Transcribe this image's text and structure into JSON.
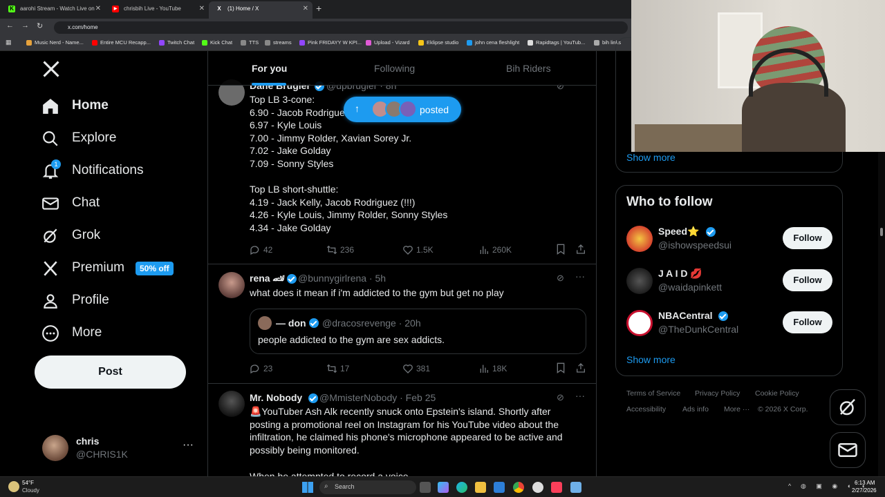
{
  "browser": {
    "tabs": [
      {
        "title": "aarohi Stream - Watch Live on",
        "fav": "K",
        "color": "#53fc18"
      },
      {
        "title": "chrisbih Live - YouTube",
        "fav": "▶",
        "color": "#ff0000"
      },
      {
        "title": "(1) Home / X",
        "fav": "X",
        "color": "#ffffff"
      }
    ],
    "url": "x.com/home",
    "bookmarks": [
      "Music Nerd - Name...",
      "Entire MCU Recapp...",
      "Twitch Chat",
      "Kick Chat",
      "TTS",
      "streams",
      "Pink FRIDAYY W KPI...",
      "Upload - Vizard",
      "Eklipse studio",
      "john cena fleshlight",
      "Rapidtags | YouTub...",
      "bih links"
    ]
  },
  "sidebar": {
    "items": [
      {
        "label": "Home",
        "icon": "home-icon"
      },
      {
        "label": "Explore",
        "icon": "search-icon"
      },
      {
        "label": "Notifications",
        "icon": "bell-icon",
        "badge": "1"
      },
      {
        "label": "Chat",
        "icon": "mail-icon"
      },
      {
        "label": "Grok",
        "icon": "grok-icon"
      },
      {
        "label": "Premium",
        "icon": "x-logo-icon",
        "badge": "50% off"
      },
      {
        "label": "Profile",
        "icon": "person-icon"
      },
      {
        "label": "More",
        "icon": "more-circle-icon"
      }
    ],
    "post_label": "Post",
    "account": {
      "name": "chris",
      "handle": "@CHRIS1K"
    }
  },
  "feed": {
    "tabs": [
      "For you",
      "Following",
      "Bih Riders"
    ],
    "posted_pill": "posted",
    "tweets": [
      {
        "name": "Dane Brugler",
        "handle": "@dpbrugler · 8h",
        "text": "Top LB 3-cone:\n6.90 - Jacob Rodriguez\n6.97 - Kyle Louis\n7.00 - Jimmy Rolder, Xavian Sorey Jr.\n7.02 - Jake Golday\n7.09 - Sonny Styles\n\nTop LB short-shuttle:\n4.19 - Jack Kelly, Jacob Rodriguez (!!!)\n4.26 - Kyle Louis, Jimmy Rolder, Sonny Styles\n4.34 - Jake Golday",
        "replies": "42",
        "reposts": "236",
        "likes": "1.5K",
        "views": "260K"
      },
      {
        "name": "rena 🏎",
        "handle": "@bunnygirlrena · 5h",
        "text": "what does it mean if i'm addicted to the gym but get no play",
        "quote": {
          "name": "— don",
          "handle": "@dracosrevenge · 20h",
          "text": "people addicted to the gym are sex addicts."
        },
        "replies": "23",
        "reposts": "17",
        "likes": "381",
        "views": "18K"
      },
      {
        "name": "Mr. Nobody",
        "handle": "@MmisterNobody · Feb 25",
        "text": "🚨YouTuber Ash Alk recently snuck onto Epstein's island. Shortly after\nposting a promotional reel on Instagram for his YouTube video about the\ninfiltration, he claimed his phone's microphone appeared to be active and\npossibly being monitored.",
        "cut_text": "When he attempted to record a voice"
      }
    ]
  },
  "right": {
    "show_more_top": "Show more",
    "who_to_follow_title": "Who to follow",
    "suggestions": [
      {
        "name": "Speed⭐",
        "handle": "@ishowspeedsui",
        "follow": "Follow"
      },
      {
        "name": "J A I D 💋",
        "handle": "@waidapinkett",
        "follow": "Follow"
      },
      {
        "name": "NBACentral",
        "handle": "@TheDunkCentral",
        "follow": "Follow"
      }
    ],
    "show_more": "Show more",
    "footer": {
      "terms": "Terms of Service",
      "privacy": "Privacy Policy",
      "cookie": "Cookie Policy",
      "accessibility": "Accessibility",
      "ads": "Ads info",
      "more": "More ···",
      "copyright": "© 2026 X Corp."
    }
  },
  "taskbar": {
    "weather_temp": "54°F",
    "weather_desc": "Cloudy",
    "search": "Search",
    "time": "6:13 AM",
    "date": "2/27/2026"
  }
}
